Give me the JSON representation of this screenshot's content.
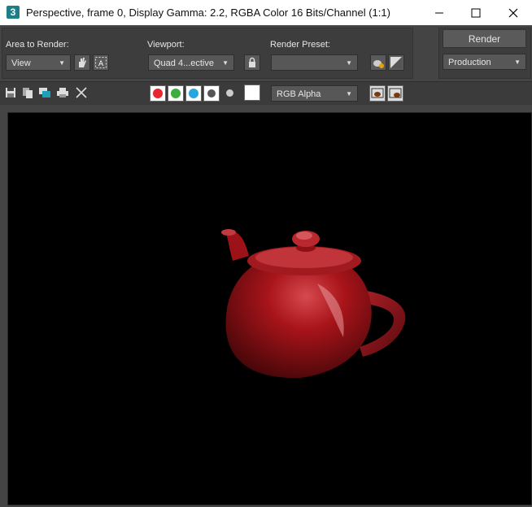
{
  "window": {
    "app_icon_label": "3",
    "title": "Perspective, frame 0, Display Gamma: 2.2, RGBA Color 16 Bits/Channel (1:1)"
  },
  "toolbar": {
    "area_label": "Area to Render:",
    "area_value": "View",
    "viewport_label": "Viewport:",
    "viewport_value": "Quad 4...ective",
    "preset_label": "Render Preset:",
    "preset_value": "",
    "render_button": "Render",
    "production_value": "Production"
  },
  "channels": {
    "red": "#e8262f",
    "green": "#3dad3d",
    "blue": "#27a6e0",
    "display_value": "RGB Alpha"
  },
  "image": {
    "subject": "teapot",
    "color": "#a8141a"
  }
}
